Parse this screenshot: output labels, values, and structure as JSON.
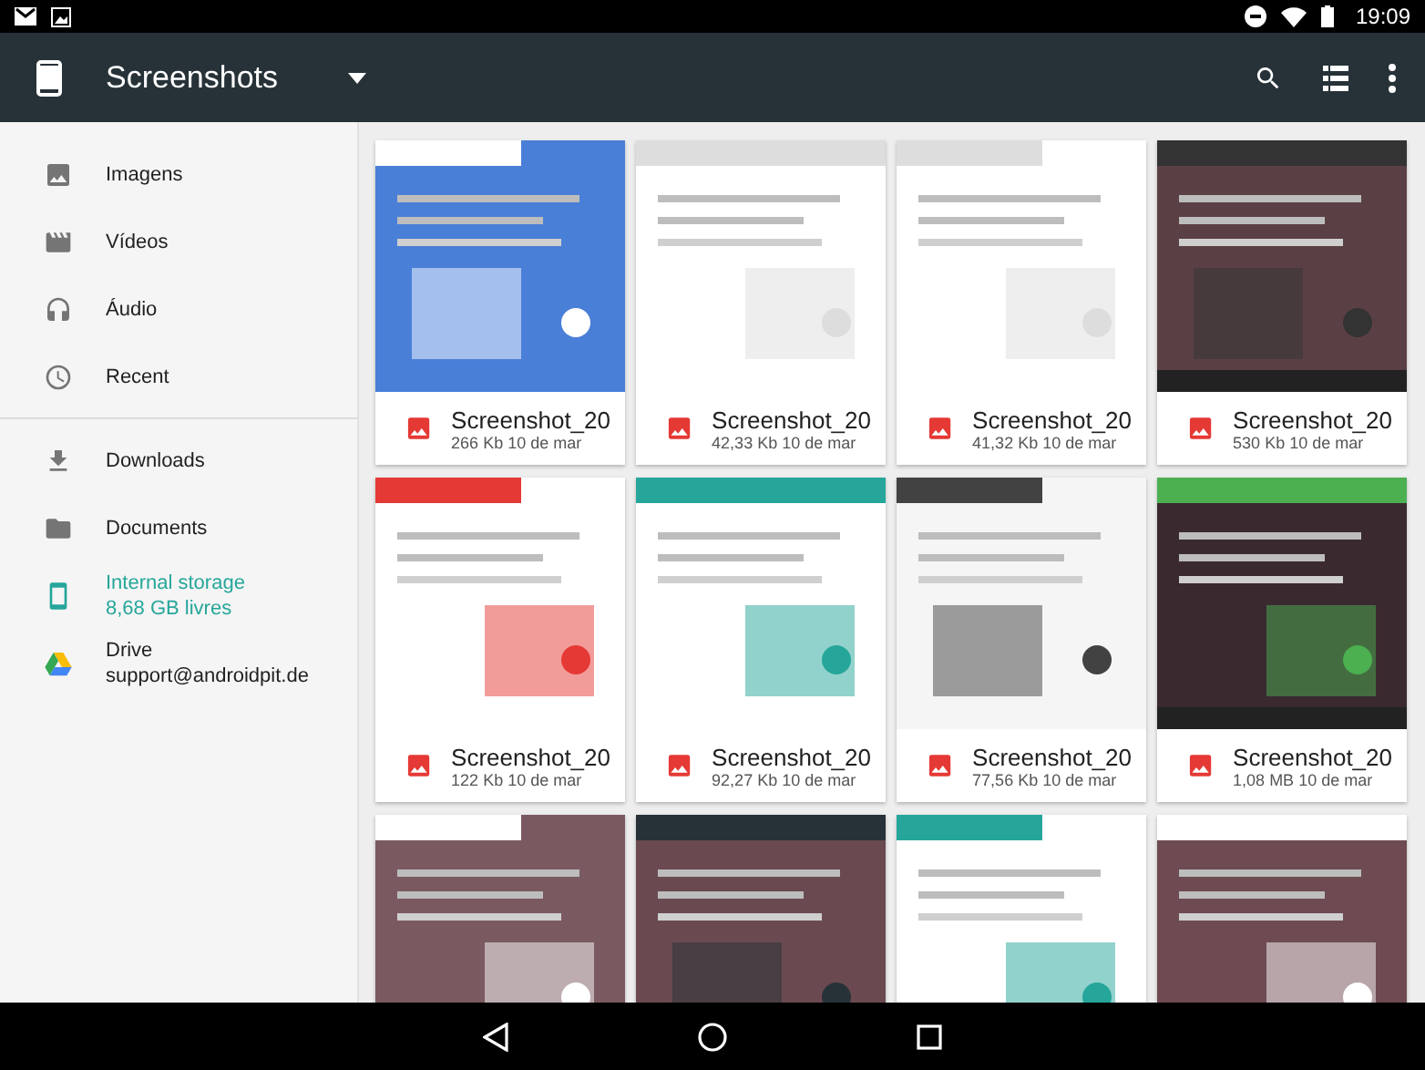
{
  "status_bar": {
    "time": "19:09"
  },
  "app_bar": {
    "title": "Screenshots"
  },
  "sidebar": {
    "groups": [
      {
        "items": [
          {
            "kind": "images",
            "label": "Imagens",
            "selected": false
          },
          {
            "kind": "videos",
            "label": "Vídeos",
            "selected": false
          },
          {
            "kind": "audio",
            "label": "Áudio",
            "selected": false
          },
          {
            "kind": "recent",
            "label": "Recent",
            "selected": false
          }
        ]
      },
      {
        "items": [
          {
            "kind": "downloads",
            "label": "Downloads",
            "selected": false
          },
          {
            "kind": "folder",
            "label": "Documents",
            "selected": false
          },
          {
            "kind": "device",
            "label": "Internal storage",
            "subtitle": "8,68 GB livres",
            "selected": true
          },
          {
            "kind": "drive",
            "label": "Drive",
            "subtitle": "support@androidpit.de",
            "selected": false
          }
        ]
      }
    ]
  },
  "files": [
    {
      "kind": "file",
      "name": "Screenshot_20",
      "details": "266 Kb 10 de mar"
    },
    {
      "kind": "file",
      "name": "Screenshot_20",
      "details": "42,33 Kb 10 de mar"
    },
    {
      "kind": "file",
      "name": "Screenshot_20",
      "details": "41,32 Kb 10 de mar"
    },
    {
      "kind": "file",
      "name": "Screenshot_20",
      "details": "530 Kb 10 de mar"
    },
    {
      "kind": "file",
      "name": "Screenshot_20",
      "details": "122 Kb 10 de mar"
    },
    {
      "kind": "file",
      "name": "Screenshot_20",
      "details": "92,27 Kb 10 de mar"
    },
    {
      "kind": "file",
      "name": "Screenshot_20",
      "details": "77,56 Kb 10 de mar"
    },
    {
      "kind": "file",
      "name": "Screenshot_20",
      "details": "1,08 MB 10 de mar"
    },
    {
      "kind": "picture"
    },
    {
      "kind": "picture"
    },
    {
      "kind": "picture"
    },
    {
      "kind": "picture"
    }
  ]
}
